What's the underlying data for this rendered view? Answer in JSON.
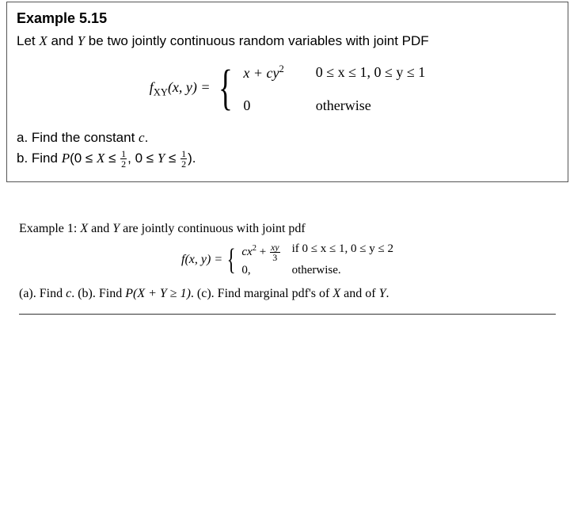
{
  "example1": {
    "title": "Example 5.15",
    "intro_prefix": "Let ",
    "var_x": "X",
    "intro_and": " and ",
    "var_y": "Y",
    "intro_suffix": " be two jointly continuous random variables with joint PDF",
    "lhs_fn": "f",
    "lhs_sub": "XY",
    "lhs_args": "(x, y) = ",
    "case1_expr": "x + cy",
    "case1_exp": "2",
    "case1_cond": "0 ≤ x ≤ 1, 0 ≤ y ≤ 1",
    "case2_expr": "0",
    "case2_cond": "otherwise",
    "qa_prefix": "a. Find the constant ",
    "qa_var": "c",
    "qa_suffix": ".",
    "qb_prefix": "b. Find ",
    "qb_p": "P",
    "qb_open": "(0 ≤ ",
    "qb_x": "X",
    "qb_leq1": " ≤ ",
    "qb_frac1_num": "1",
    "qb_frac1_den": "2",
    "qb_mid": ", 0 ≤ ",
    "qb_y": "Y",
    "qb_leq2": " ≤ ",
    "qb_frac2_num": "1",
    "qb_frac2_den": "2",
    "qb_close": ").",
    "brace": "{"
  },
  "example2": {
    "intro_prefix": "Example 1: ",
    "var_x": "X",
    "intro_and": " and ",
    "var_y": "Y",
    "intro_suffix": " are jointly continuous with joint pdf",
    "lhs": "f(x, y) = ",
    "brace": "{",
    "c1_a": "cx",
    "c1_exp": "2",
    "c1_plus": " + ",
    "c1_num": "xy",
    "c1_den": "3",
    "c1_cond_if": "if ",
    "c1_cond": "0 ≤ x ≤ 1, 0 ≤ y ≤ 2",
    "c2_expr": "0,",
    "c2_cond": "otherwise.",
    "q_a": "(a). Find ",
    "q_a_var": "c",
    "q_a_end": ". ",
    "q_b": "(b). Find ",
    "q_b_p": "P",
    "q_b_in": "(X + Y ≥ 1)",
    "q_b_end": ". ",
    "q_c": "(c). Find marginal pdf's of ",
    "q_c_x": "X",
    "q_c_and": " and of ",
    "q_c_y": "Y",
    "q_c_end": "."
  }
}
